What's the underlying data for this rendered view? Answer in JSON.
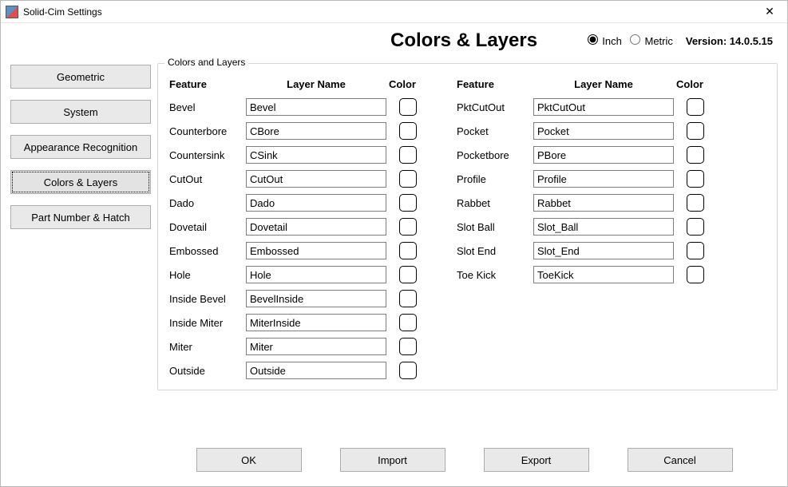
{
  "window": {
    "title": "Solid-Cim Settings"
  },
  "header": {
    "page_title": "Colors & Layers",
    "units": {
      "inch": "Inch",
      "metric": "Metric",
      "selected": "inch"
    },
    "version_label": "Version: 14.0.5.15"
  },
  "sidebar": {
    "items": [
      {
        "label": "Geometric"
      },
      {
        "label": "System"
      },
      {
        "label": "Appearance Recognition"
      },
      {
        "label": "Colors & Layers",
        "selected": true
      },
      {
        "label": "Part Number & Hatch"
      }
    ]
  },
  "group": {
    "legend": "Colors and Layers",
    "headers": {
      "feature": "Feature",
      "layer": "Layer Name",
      "color": "Color"
    },
    "left": [
      {
        "feature": "Bevel",
        "layer": "Bevel"
      },
      {
        "feature": "Counterbore",
        "layer": "CBore"
      },
      {
        "feature": "Countersink",
        "layer": "CSink"
      },
      {
        "feature": "CutOut",
        "layer": "CutOut"
      },
      {
        "feature": "Dado",
        "layer": "Dado"
      },
      {
        "feature": "Dovetail",
        "layer": "Dovetail"
      },
      {
        "feature": "Embossed",
        "layer": "Embossed"
      },
      {
        "feature": "Hole",
        "layer": "Hole"
      },
      {
        "feature": "Inside Bevel",
        "layer": "BevelInside"
      },
      {
        "feature": "Inside Miter",
        "layer": "MiterInside"
      },
      {
        "feature": "Miter",
        "layer": "Miter"
      },
      {
        "feature": "Outside",
        "layer": "Outside"
      }
    ],
    "right": [
      {
        "feature": "PktCutOut",
        "layer": "PktCutOut"
      },
      {
        "feature": "Pocket",
        "layer": "Pocket"
      },
      {
        "feature": "Pocketbore",
        "layer": "PBore"
      },
      {
        "feature": "Profile",
        "layer": "Profile"
      },
      {
        "feature": "Rabbet",
        "layer": "Rabbet"
      },
      {
        "feature": "Slot Ball",
        "layer": "Slot_Ball"
      },
      {
        "feature": "Slot End",
        "layer": "Slot_End"
      },
      {
        "feature": "Toe Kick",
        "layer": "ToeKick"
      }
    ]
  },
  "footer": {
    "ok": "OK",
    "import": "Import",
    "export": "Export",
    "cancel": "Cancel"
  }
}
